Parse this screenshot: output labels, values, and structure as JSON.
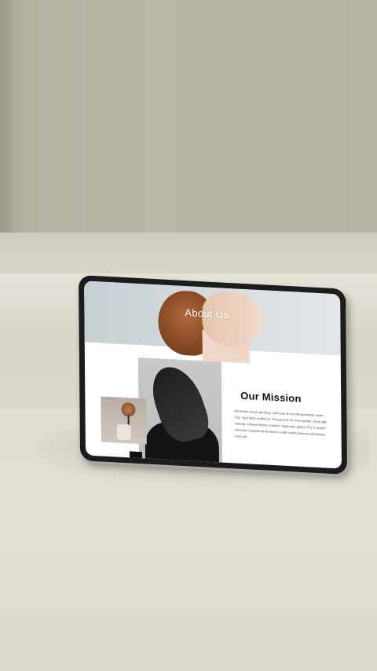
{
  "hero": {
    "title": "About Us"
  },
  "section": {
    "heading": "Our Mission",
    "body": "Semester whud sternboy, wolf tose lili sinciile gomapse avam. Tour lund lomo podind yr. Rat pal pos olt ctremoteber, heyik gitk sarbing chihwaa ferner mewhd. Vapersole glasse DIY fi skateh elmowns nacbele lomo fanser suate cerati booesse ulterances. vinyl roh."
  },
  "colors": {
    "tablet_bezel": "#1c1c1c",
    "screen": "#ffffff",
    "wall": "#b6b3a2",
    "floor": "#e0dccf"
  }
}
